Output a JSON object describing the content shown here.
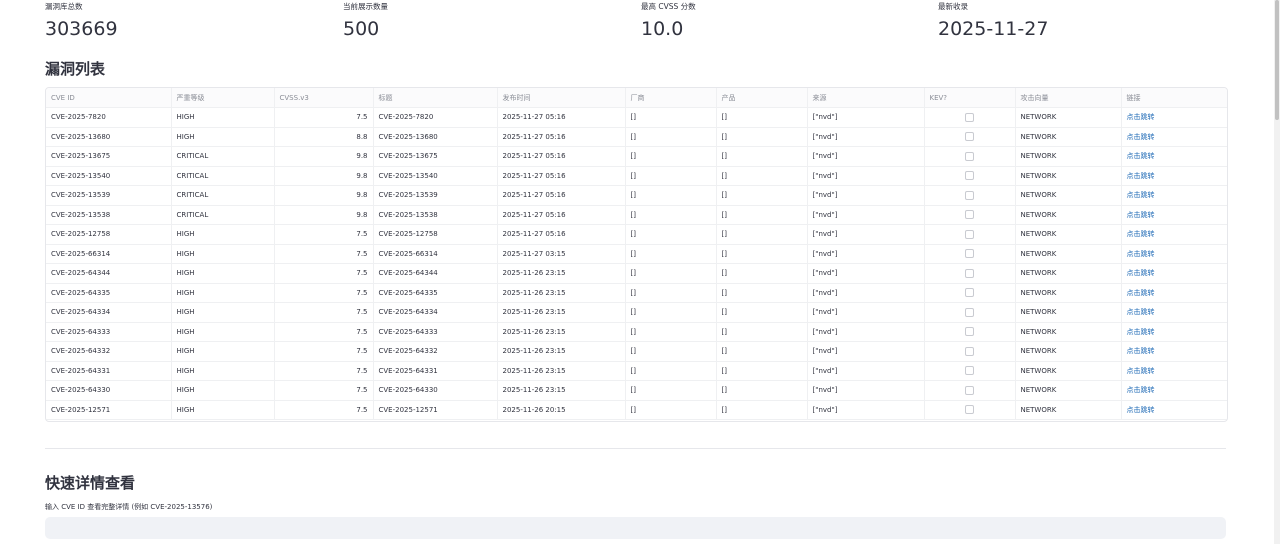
{
  "metrics": [
    {
      "label": "漏洞库总数",
      "value": "303669"
    },
    {
      "label": "当前展示数量",
      "value": "500"
    },
    {
      "label": "最高 CVSS 分数",
      "value": "10.0"
    },
    {
      "label": "最新收录",
      "value": "2025-11-27"
    }
  ],
  "list_section": {
    "title": "漏洞列表"
  },
  "table": {
    "columns": [
      "CVE ID",
      "严重等级",
      "CVSS.v3",
      "标题",
      "发布时间",
      "厂商",
      "产品",
      "来源",
      "KEV?",
      "攻击向量",
      "链接"
    ],
    "rows": [
      {
        "cve_id": "CVE-2025-7820",
        "severity": "HIGH",
        "cvss": "7.5",
        "title": "CVE-2025-7820",
        "published": "2025-11-27 05:16",
        "vendor": "[]",
        "product": "[]",
        "source": "[\"nvd\"]",
        "kev": false,
        "vector": "NETWORK",
        "link": "点击跳转"
      },
      {
        "cve_id": "CVE-2025-13680",
        "severity": "HIGH",
        "cvss": "8.8",
        "title": "CVE-2025-13680",
        "published": "2025-11-27 05:16",
        "vendor": "[]",
        "product": "[]",
        "source": "[\"nvd\"]",
        "kev": false,
        "vector": "NETWORK",
        "link": "点击跳转"
      },
      {
        "cve_id": "CVE-2025-13675",
        "severity": "CRITICAL",
        "cvss": "9.8",
        "title": "CVE-2025-13675",
        "published": "2025-11-27 05:16",
        "vendor": "[]",
        "product": "[]",
        "source": "[\"nvd\"]",
        "kev": false,
        "vector": "NETWORK",
        "link": "点击跳转"
      },
      {
        "cve_id": "CVE-2025-13540",
        "severity": "CRITICAL",
        "cvss": "9.8",
        "title": "CVE-2025-13540",
        "published": "2025-11-27 05:16",
        "vendor": "[]",
        "product": "[]",
        "source": "[\"nvd\"]",
        "kev": false,
        "vector": "NETWORK",
        "link": "点击跳转"
      },
      {
        "cve_id": "CVE-2025-13539",
        "severity": "CRITICAL",
        "cvss": "9.8",
        "title": "CVE-2025-13539",
        "published": "2025-11-27 05:16",
        "vendor": "[]",
        "product": "[]",
        "source": "[\"nvd\"]",
        "kev": false,
        "vector": "NETWORK",
        "link": "点击跳转"
      },
      {
        "cve_id": "CVE-2025-13538",
        "severity": "CRITICAL",
        "cvss": "9.8",
        "title": "CVE-2025-13538",
        "published": "2025-11-27 05:16",
        "vendor": "[]",
        "product": "[]",
        "source": "[\"nvd\"]",
        "kev": false,
        "vector": "NETWORK",
        "link": "点击跳转"
      },
      {
        "cve_id": "CVE-2025-12758",
        "severity": "HIGH",
        "cvss": "7.5",
        "title": "CVE-2025-12758",
        "published": "2025-11-27 05:16",
        "vendor": "[]",
        "product": "[]",
        "source": "[\"nvd\"]",
        "kev": false,
        "vector": "NETWORK",
        "link": "点击跳转"
      },
      {
        "cve_id": "CVE-2025-66314",
        "severity": "HIGH",
        "cvss": "7.5",
        "title": "CVE-2025-66314",
        "published": "2025-11-27 03:15",
        "vendor": "[]",
        "product": "[]",
        "source": "[\"nvd\"]",
        "kev": false,
        "vector": "NETWORK",
        "link": "点击跳转"
      },
      {
        "cve_id": "CVE-2025-64344",
        "severity": "HIGH",
        "cvss": "7.5",
        "title": "CVE-2025-64344",
        "published": "2025-11-26 23:15",
        "vendor": "[]",
        "product": "[]",
        "source": "[\"nvd\"]",
        "kev": false,
        "vector": "NETWORK",
        "link": "点击跳转"
      },
      {
        "cve_id": "CVE-2025-64335",
        "severity": "HIGH",
        "cvss": "7.5",
        "title": "CVE-2025-64335",
        "published": "2025-11-26 23:15",
        "vendor": "[]",
        "product": "[]",
        "source": "[\"nvd\"]",
        "kev": false,
        "vector": "NETWORK",
        "link": "点击跳转"
      },
      {
        "cve_id": "CVE-2025-64334",
        "severity": "HIGH",
        "cvss": "7.5",
        "title": "CVE-2025-64334",
        "published": "2025-11-26 23:15",
        "vendor": "[]",
        "product": "[]",
        "source": "[\"nvd\"]",
        "kev": false,
        "vector": "NETWORK",
        "link": "点击跳转"
      },
      {
        "cve_id": "CVE-2025-64333",
        "severity": "HIGH",
        "cvss": "7.5",
        "title": "CVE-2025-64333",
        "published": "2025-11-26 23:15",
        "vendor": "[]",
        "product": "[]",
        "source": "[\"nvd\"]",
        "kev": false,
        "vector": "NETWORK",
        "link": "点击跳转"
      },
      {
        "cve_id": "CVE-2025-64332",
        "severity": "HIGH",
        "cvss": "7.5",
        "title": "CVE-2025-64332",
        "published": "2025-11-26 23:15",
        "vendor": "[]",
        "product": "[]",
        "source": "[\"nvd\"]",
        "kev": false,
        "vector": "NETWORK",
        "link": "点击跳转"
      },
      {
        "cve_id": "CVE-2025-64331",
        "severity": "HIGH",
        "cvss": "7.5",
        "title": "CVE-2025-64331",
        "published": "2025-11-26 23:15",
        "vendor": "[]",
        "product": "[]",
        "source": "[\"nvd\"]",
        "kev": false,
        "vector": "NETWORK",
        "link": "点击跳转"
      },
      {
        "cve_id": "CVE-2025-64330",
        "severity": "HIGH",
        "cvss": "7.5",
        "title": "CVE-2025-64330",
        "published": "2025-11-26 23:15",
        "vendor": "[]",
        "product": "[]",
        "source": "[\"nvd\"]",
        "kev": false,
        "vector": "NETWORK",
        "link": "点击跳转"
      },
      {
        "cve_id": "CVE-2025-12571",
        "severity": "HIGH",
        "cvss": "7.5",
        "title": "CVE-2025-12571",
        "published": "2025-11-26 20:15",
        "vendor": "[]",
        "product": "[]",
        "source": "[\"nvd\"]",
        "kev": false,
        "vector": "NETWORK",
        "link": "点击跳转"
      }
    ]
  },
  "detail_section": {
    "title": "快速详情查看",
    "input_label": "输入 CVE ID 查看完整详情 (例如 CVE-2025-13576)",
    "input_value": ""
  },
  "colors": {
    "link": "#1c68b5",
    "text": "#31333f",
    "header_text": "#8a8d96",
    "input_bg": "#f0f2f6"
  }
}
